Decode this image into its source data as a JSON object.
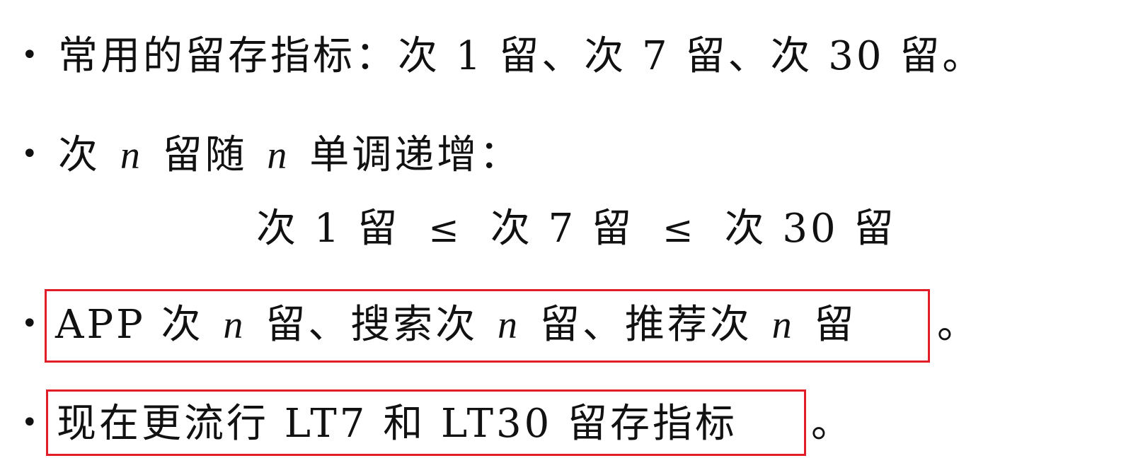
{
  "bullets": [
    {
      "text": "常用的留存指标：次 1 留、次 7 留、次 30 留。"
    },
    {
      "prefix": "次 ",
      "var1": "n",
      "middle": " 留随 ",
      "var2": "n",
      "suffix": " 单调递增："
    },
    {
      "p1": "APP 次 ",
      "v1": "n",
      "p2": " 留、搜索次 ",
      "v2": "n",
      "p3": " 留、推荐次 ",
      "v3": "n",
      "p4": " 留",
      "after": "。"
    },
    {
      "boxed": "现在更流行 LT7 和 LT30 留存指标",
      "after": "。"
    }
  ],
  "inequality": {
    "a": "次 1 留",
    "op": "≤",
    "b": "次 7 留",
    "c": "次 30 留"
  },
  "bullet_symbol": "•",
  "highlight_color": "#e11d2a"
}
